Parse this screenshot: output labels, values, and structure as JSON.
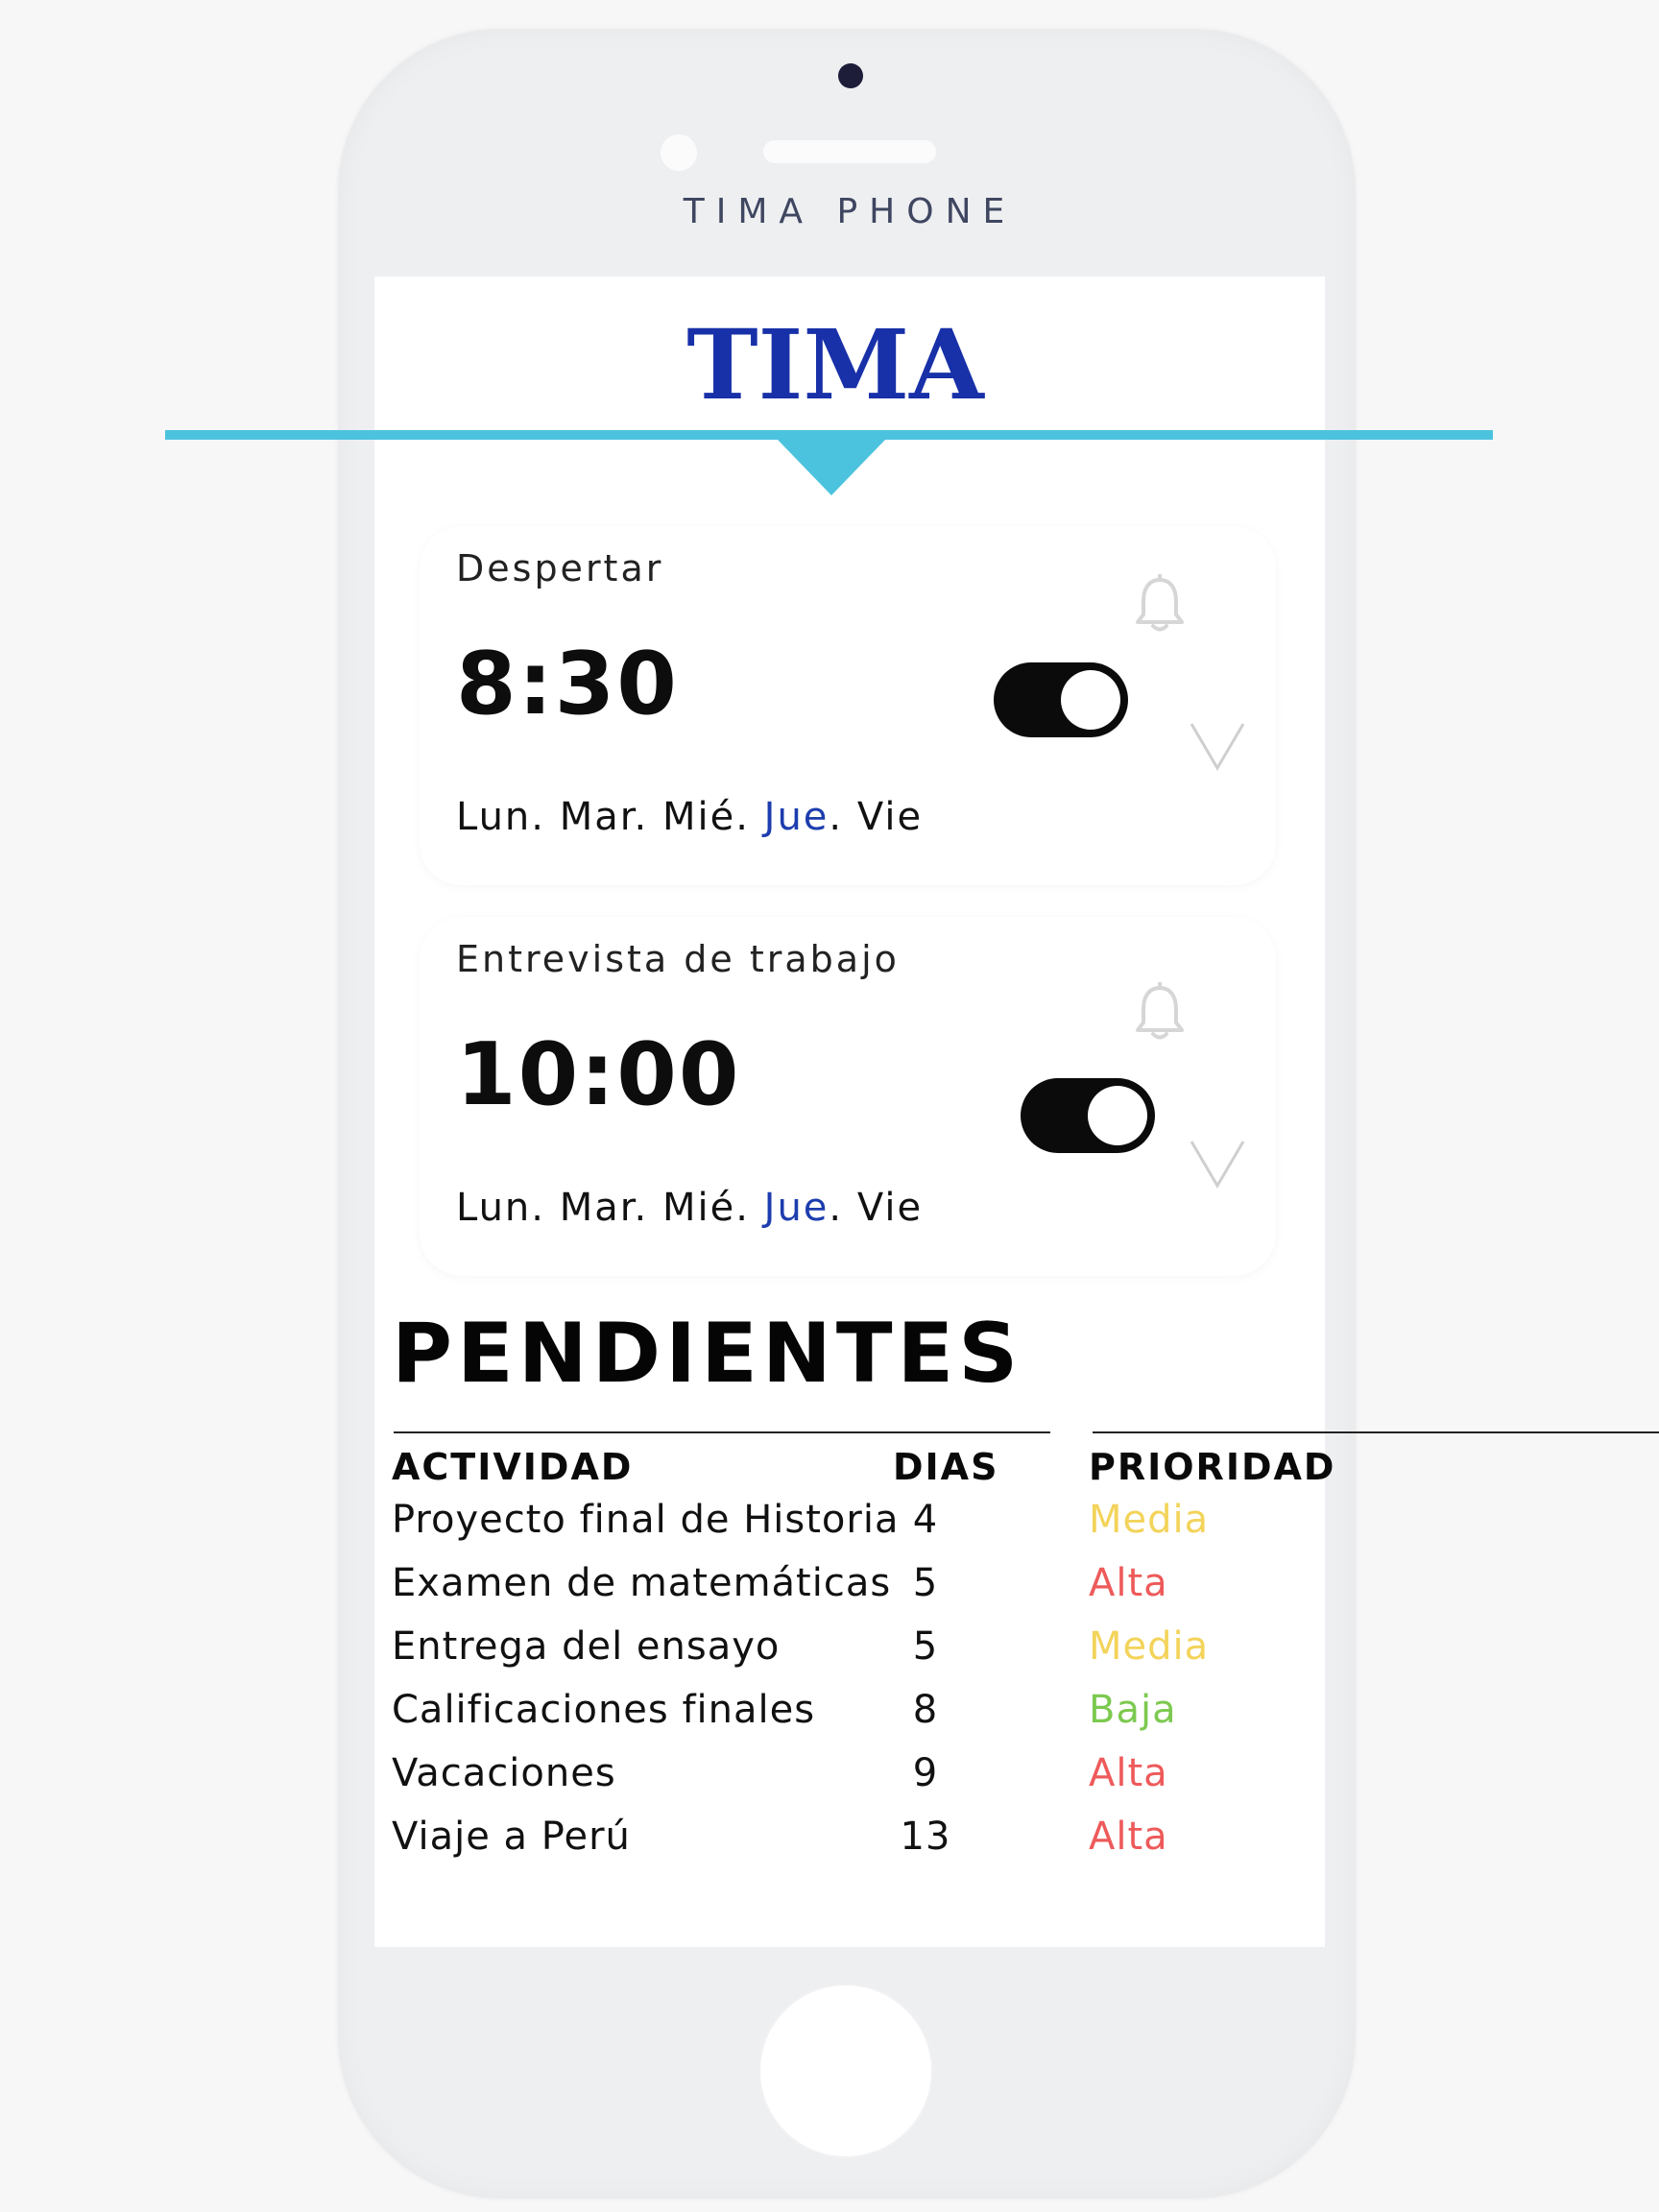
{
  "device": {
    "brand": "TIMA PHONE"
  },
  "app": {
    "title": "TIMA"
  },
  "alarms": [
    {
      "label": "Despertar",
      "time": "8:30",
      "enabled": true,
      "days": [
        {
          "name": "Lun",
          "sep": ". "
        },
        {
          "name": "Mar",
          "sep": ". "
        },
        {
          "name": "Mié",
          "sep": ". "
        },
        {
          "name": "Jue",
          "sep": ". "
        },
        {
          "name": "Vie",
          "sep": ""
        }
      ],
      "active_day": "Jue"
    },
    {
      "label": "Entrevista de trabajo",
      "time": "10:00",
      "enabled": true,
      "days": [
        {
          "name": "Lun",
          "sep": ". "
        },
        {
          "name": "Mar",
          "sep": ". "
        },
        {
          "name": "Mié",
          "sep": ". "
        },
        {
          "name": "Jue",
          "sep": ". "
        },
        {
          "name": "Vie",
          "sep": ""
        }
      ],
      "active_day": "Jue"
    }
  ],
  "pendientes": {
    "title": "PENDIENTES",
    "headers": {
      "activity": "ACTIVIDAD",
      "days": "DIAS",
      "priority": "PRIORIDAD"
    },
    "rows": [
      {
        "activity": "Proyecto final de Historia",
        "days": "4",
        "priority": "Media"
      },
      {
        "activity": "Examen de matemáticas",
        "days": "5",
        "priority": "Alta"
      },
      {
        "activity": "Entrega del ensayo",
        "days": "5",
        "priority": "Media"
      },
      {
        "activity": "Calificaciones finales",
        "days": "8",
        "priority": "Baja"
      },
      {
        "activity": "Vacaciones",
        "days": "9",
        "priority": "Alta"
      },
      {
        "activity": "Viaje a Perú",
        "days": "13",
        "priority": "Alta"
      }
    ]
  },
  "colors": {
    "title_blue": "#1830a8",
    "accent_cyan": "#4cc3de",
    "active_day": "#1d3dae",
    "priority_media": "#f3d35a",
    "priority_alta": "#ee5a5a",
    "priority_baja": "#7cc94f"
  },
  "icons": {
    "bell": "bell-icon",
    "chevron": "chevron-down-icon"
  }
}
